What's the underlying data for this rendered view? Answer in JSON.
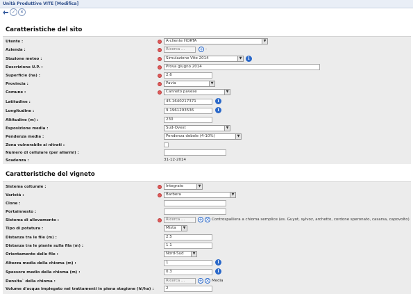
{
  "window": {
    "title": "Unità Produttive VITE [Modifica]"
  },
  "toolbar": {
    "back_icon": "back-arrow-icon",
    "confirm_icon": "check-icon",
    "cancel_icon": "close-icon"
  },
  "sito": {
    "title": "Caratteristiche del sito",
    "utente": {
      "label": "Utente :",
      "value": "A-cliente HORTA"
    },
    "azienda": {
      "label": "Azienda :",
      "placeholder": "Ricerca ..."
    },
    "stazione": {
      "label": "Stazione meteo :",
      "value": "Simulazione Vite 2014"
    },
    "descrizione": {
      "label": "Descrizione U.P. :",
      "value": "Prova giugno 2014"
    },
    "superficie": {
      "label": "Superficie (ha) :",
      "value": "2,6"
    },
    "provincia": {
      "label": "Provincia :",
      "value": "Pavia"
    },
    "comune": {
      "label": "Comune :",
      "value": "Canneto pavese"
    },
    "latitudine": {
      "label": "Latitudine :",
      "value": "45.1640217371"
    },
    "longitudine": {
      "label": "Longitudine :",
      "value": "9.1961293536"
    },
    "altitudine": {
      "label": "Altitudine (m) :",
      "value": "230"
    },
    "esposizione": {
      "label": "Esposizione media :",
      "value": "Sud-Ovest"
    },
    "pendenza": {
      "label": "Pendenza media :",
      "value": "Pendenza debole (4-10%)"
    },
    "zona": {
      "label": "Zona vulnerabile ai nitrati :"
    },
    "cellulare": {
      "label": "Numero di cellulare (per allarmi) :",
      "value": ""
    },
    "scadenza": {
      "label": "Scadenza :",
      "value": "31-12-2014"
    }
  },
  "vigneto": {
    "title": "Caratteristiche del vigneto",
    "sistema": {
      "label": "Sistema colturale :",
      "value": "Integrato"
    },
    "varieta": {
      "label": "Varietà :",
      "value": "Barbera"
    },
    "clone": {
      "label": "Clone :",
      "value": ""
    },
    "portainnesto": {
      "label": "Portainnesto :",
      "value": ""
    },
    "allevamento": {
      "label": "Sistema di allevamento :",
      "placeholder": "Ricerca ...",
      "note": "Controspalliera a chioma semplice (es. Guyot, sylvoz, archetto, cordone speronato, casarsa, capovolto)"
    },
    "potatura": {
      "label": "Tipo di potatura :",
      "value": "Mista"
    },
    "distanza_file": {
      "label": "Distanza tra le file (m) :",
      "value": "2.5"
    },
    "distanza_piante": {
      "label": "Distanza tra le piante sulla fila (m) :",
      "value": "1.1"
    },
    "orientamento": {
      "label": "Orientamento delle file :",
      "value": "Nord-Sud"
    },
    "altezza": {
      "label": "Altezza media della chioma (m) :",
      "value": "1"
    },
    "spessore": {
      "label": "Spessore medio della chioma (m) :",
      "value": "0.3"
    },
    "densita": {
      "label": "Densita` della chioma :",
      "placeholder": "Ricerca ...",
      "note": "Media"
    },
    "volume": {
      "label": "Volume d'acqua impiegato nei trattamenti in piena stagione (hl/ha) :",
      "value": "2"
    }
  }
}
